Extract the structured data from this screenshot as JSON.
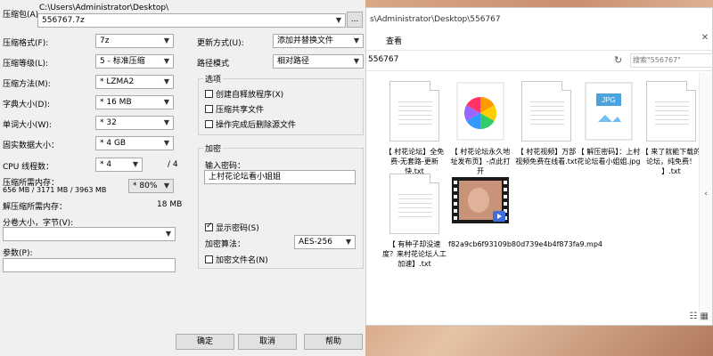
{
  "dialog": {
    "archive_label": "压缩包(A)",
    "archive_path": "C:\\Users\\Administrator\\Desktop\\",
    "archive_name": "556767.7z",
    "browse_label": "...",
    "format_label": "压缩格式(F):",
    "format_value": "7z",
    "level_label": "压缩等级(L):",
    "level_value": "5 - 标准压缩",
    "method_label": "压缩方法(M):",
    "method_value": "* LZMA2",
    "dict_label": "字典大小(D):",
    "dict_value": "* 16 MB",
    "word_label": "单词大小(W):",
    "word_value": "* 32",
    "solid_label": "固实数据大小：",
    "solid_value": "* 4 GB",
    "threads_label": "CPU 线程数：",
    "threads_value": "* 4",
    "threads_max": "/ 4",
    "mem_label": "压缩所需内存：",
    "mem_values": "656 MB / 3171 MB / 3963 MB",
    "mem_percent": "* 80%",
    "decomp_label": "解压缩所需内存：",
    "decomp_value": "18 MB",
    "split_label": "分卷大小，字节(V):",
    "split_value": "",
    "params_label": "参数(P):",
    "params_value": "",
    "update_label": "更新方式(U):",
    "update_value": "添加并替换文件",
    "pathmode_label": "路径模式",
    "pathmode_value": "相对路径",
    "options_title": "选项",
    "opt_sfx": "创建自释放程序(X)",
    "opt_shared": "压缩共享文件",
    "opt_delete": "操作完成后删除源文件",
    "enc_title": "加密",
    "pwd_label": "输入密码：",
    "pwd_value": "上村花论坛看小姐姐",
    "show_pwd": "显示密码(S)",
    "enc_method_label": "加密算法：",
    "enc_method_value": "AES-256",
    "enc_names": "加密文件名(N)",
    "ok": "确定",
    "cancel": "取消",
    "help": "帮助"
  },
  "explorer": {
    "title_path": "s\\Administrator\\Desktop\\556767",
    "menu_view": "查看",
    "breadcrumb": "556767",
    "search_placeholder": "搜索\"556767\"",
    "close_glyph": "✕",
    "files": [
      {
        "name": "【 村花论坛】全免费-无套路-更新快.txt",
        "type": "txt"
      },
      {
        "name": "【 村花论坛永久地址发布页】-点此打开",
        "type": "web"
      },
      {
        "name": "【 村花视频】万部视频免费在线看.txt",
        "type": "txt"
      },
      {
        "name": "【 解压密码】：上村花论坛看小姐姐.jpg",
        "type": "jpg"
      },
      {
        "name": "【 来了就能下载的论坛，纯免费！ 】.txt",
        "type": "txt"
      },
      {
        "name": "【 有种子却没速度？来村花论坛人工加速】.txt",
        "type": "txt"
      },
      {
        "name": "f82a9cb6f93109b80d739e4b4f873fa9.mp4",
        "type": "mp4"
      }
    ]
  }
}
